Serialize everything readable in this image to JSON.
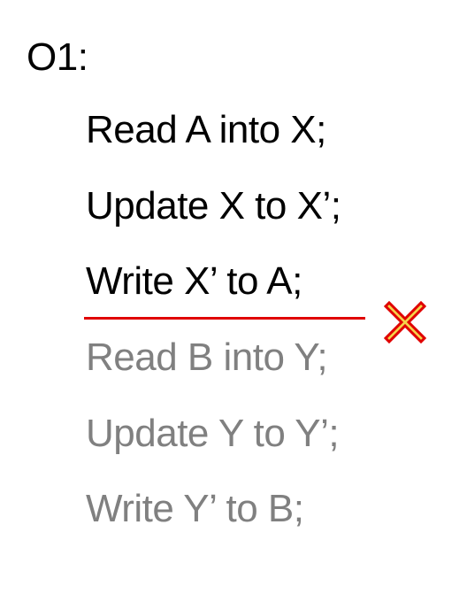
{
  "title": "O1:",
  "operations": [
    {
      "text": "Read A into X;",
      "status": "done"
    },
    {
      "text": "Update X to X’;",
      "status": "done"
    },
    {
      "text": "Write X’ to A;",
      "status": "done"
    },
    {
      "text": "Read B into Y;",
      "status": "pending"
    },
    {
      "text": "Update Y to Y’;",
      "status": "pending"
    },
    {
      "text": "Write Y’ to B;",
      "status": "pending"
    }
  ],
  "colors": {
    "done_text": "#000000",
    "pending_text": "#808080",
    "failure_line": "#e00000",
    "failure_mark": "#e00000",
    "failure_mark_fill": "#f5d24a"
  },
  "icons": {
    "failure_mark": "cross-icon"
  }
}
